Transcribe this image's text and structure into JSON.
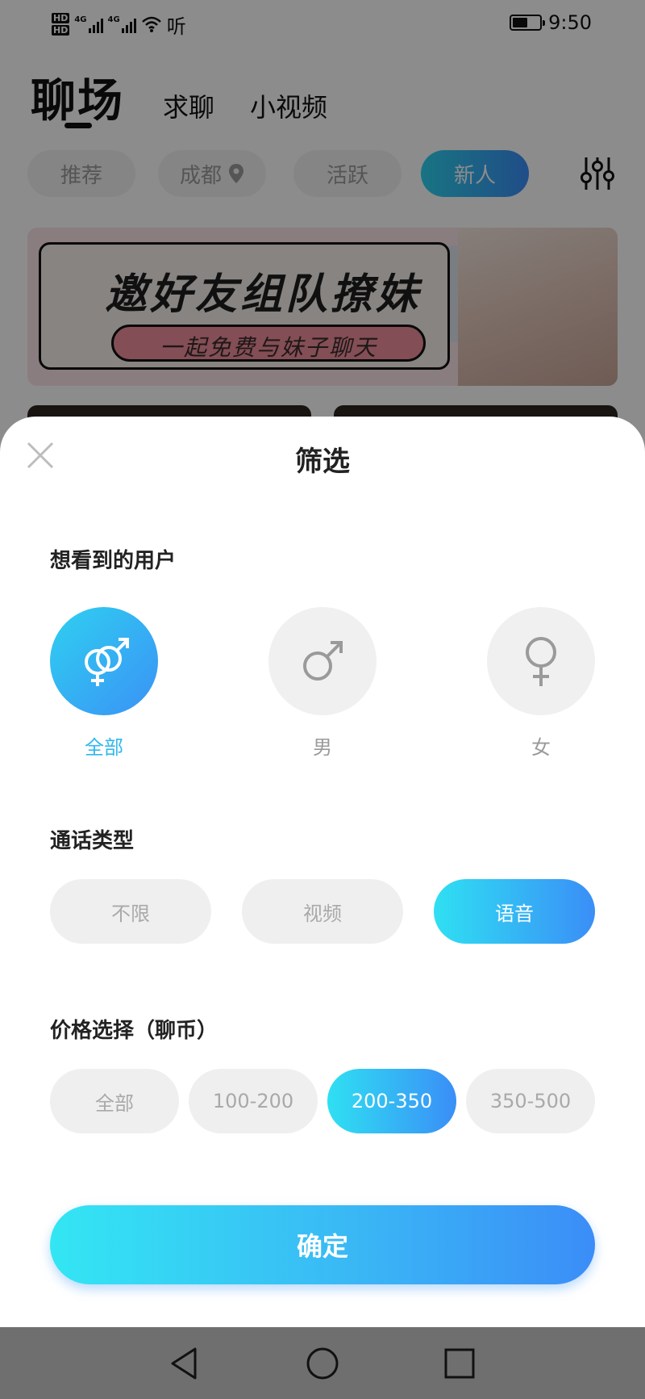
{
  "status_bar": {
    "hd1": "HD",
    "hd2": "HD",
    "net1": "4G",
    "net2": "4G",
    "extra": "听",
    "time": "9:50",
    "battery_level": 0.55
  },
  "nav": {
    "main": "聊场",
    "tab1": "求聊",
    "tab2": "小视频"
  },
  "chips": {
    "recommend": "推荐",
    "city": "成都",
    "active_users": "活跃",
    "newcomers": "新人"
  },
  "banner": {
    "title": "邀好友组队撩妹",
    "subtitle": "一起免费与妹子聊天"
  },
  "sheet": {
    "title": "筛选",
    "section_users": "想看到的用户",
    "genders": [
      {
        "label": "全部",
        "icon": "male-female-icon",
        "active": true
      },
      {
        "label": "男",
        "icon": "male-icon",
        "active": false
      },
      {
        "label": "女",
        "icon": "female-icon",
        "active": false
      }
    ],
    "section_call": "通话类型",
    "call_types": [
      {
        "label": "不限",
        "active": false
      },
      {
        "label": "视频",
        "active": false
      },
      {
        "label": "语音",
        "active": true
      }
    ],
    "section_price": "价格选择（聊币）",
    "prices": [
      {
        "label": "全部",
        "active": false
      },
      {
        "label": "100-200",
        "active": false
      },
      {
        "label": "200-350",
        "active": true
      },
      {
        "label": "350-500",
        "active": false
      }
    ],
    "confirm": "确定"
  },
  "system_nav": {
    "back": "back-triangle-icon",
    "home": "home-circle-icon",
    "recents": "recents-square-icon"
  },
  "colors": {
    "accent_start": "#2fe0f2",
    "accent_end": "#3a8ef7",
    "active_text": "#31b8ee"
  }
}
